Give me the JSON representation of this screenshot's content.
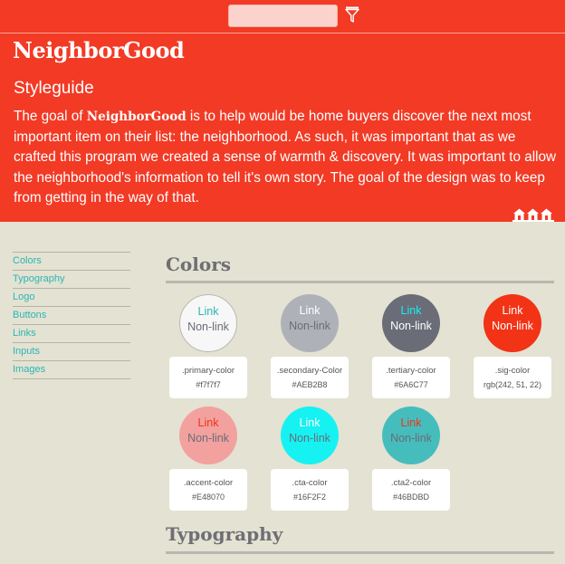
{
  "search": {
    "placeholder": "",
    "value": "",
    "icon": "filter-icon"
  },
  "header": {
    "brand": "NeighborGood",
    "subtitle": "Styleguide",
    "description_before": "The goal of ",
    "description_brand": "NeighborGood",
    "description_after": " is to help would be home buyers discover the next most important item on their list: the neighborhood. As such, it was important that as we crafted this program we created a sense of warmth & discovery. It was important to allow the neighborhood's information to tell it's own story. The goal of the design was to keep from getting in the way of that.",
    "houses_icon": "houses-icon"
  },
  "nav": {
    "items": [
      {
        "label": "Colors"
      },
      {
        "label": "Typography"
      },
      {
        "label": "Logo"
      },
      {
        "label": "Buttons"
      },
      {
        "label": "Links"
      },
      {
        "label": "Inputs"
      },
      {
        "label": "Images"
      }
    ]
  },
  "colors_section": {
    "title": "Colors",
    "swatches": [
      {
        "link": "Link",
        "nonlink": "Non-link",
        "name": ".primary-color",
        "value": "#f7f7f7",
        "bg": "#f7f7f7",
        "link_color": "#2bb5b5",
        "nonlink_color": "#6a6c77",
        "border": "#b8b8b0"
      },
      {
        "link": "Link",
        "nonlink": "Non-link",
        "name": ".secondary-Color",
        "value": "#AEB2B8",
        "bg": "#aeb2b8",
        "link_color": "#ffffff",
        "nonlink_color": "#6a6c77"
      },
      {
        "link": "Link",
        "nonlink": "Non-link",
        "name": ".tertiary-color",
        "value": "#6A6C77",
        "bg": "#6a6c77",
        "link_color": "#16f2f2",
        "nonlink_color": "#ffffff"
      },
      {
        "link": "Link",
        "nonlink": "Non-link",
        "name": ".sig-color",
        "value": "rgb(242, 51, 22)",
        "bg": "#f23316",
        "link_color": "#ffffff",
        "nonlink_color": "#ffffff"
      },
      {
        "link": "Link",
        "nonlink": "Non-link",
        "name": ".accent-color",
        "value": "#E48070",
        "bg": "#f2a19f",
        "link_color": "#f23316",
        "nonlink_color": "#6a6c77"
      },
      {
        "link": "Link",
        "nonlink": "Non-link",
        "name": ".cta-color",
        "value": "#16F2F2",
        "bg": "#16f2f2",
        "link_color": "#ffffff",
        "nonlink_color": "#6a6c77"
      },
      {
        "link": "Link",
        "nonlink": "Non-link",
        "name": ".cta2-color",
        "value": "#46BDBD",
        "bg": "#46bdbd",
        "link_color": "#f23316",
        "nonlink_color": "#6a6c77"
      }
    ]
  },
  "typography_section": {
    "title": "Typography"
  }
}
